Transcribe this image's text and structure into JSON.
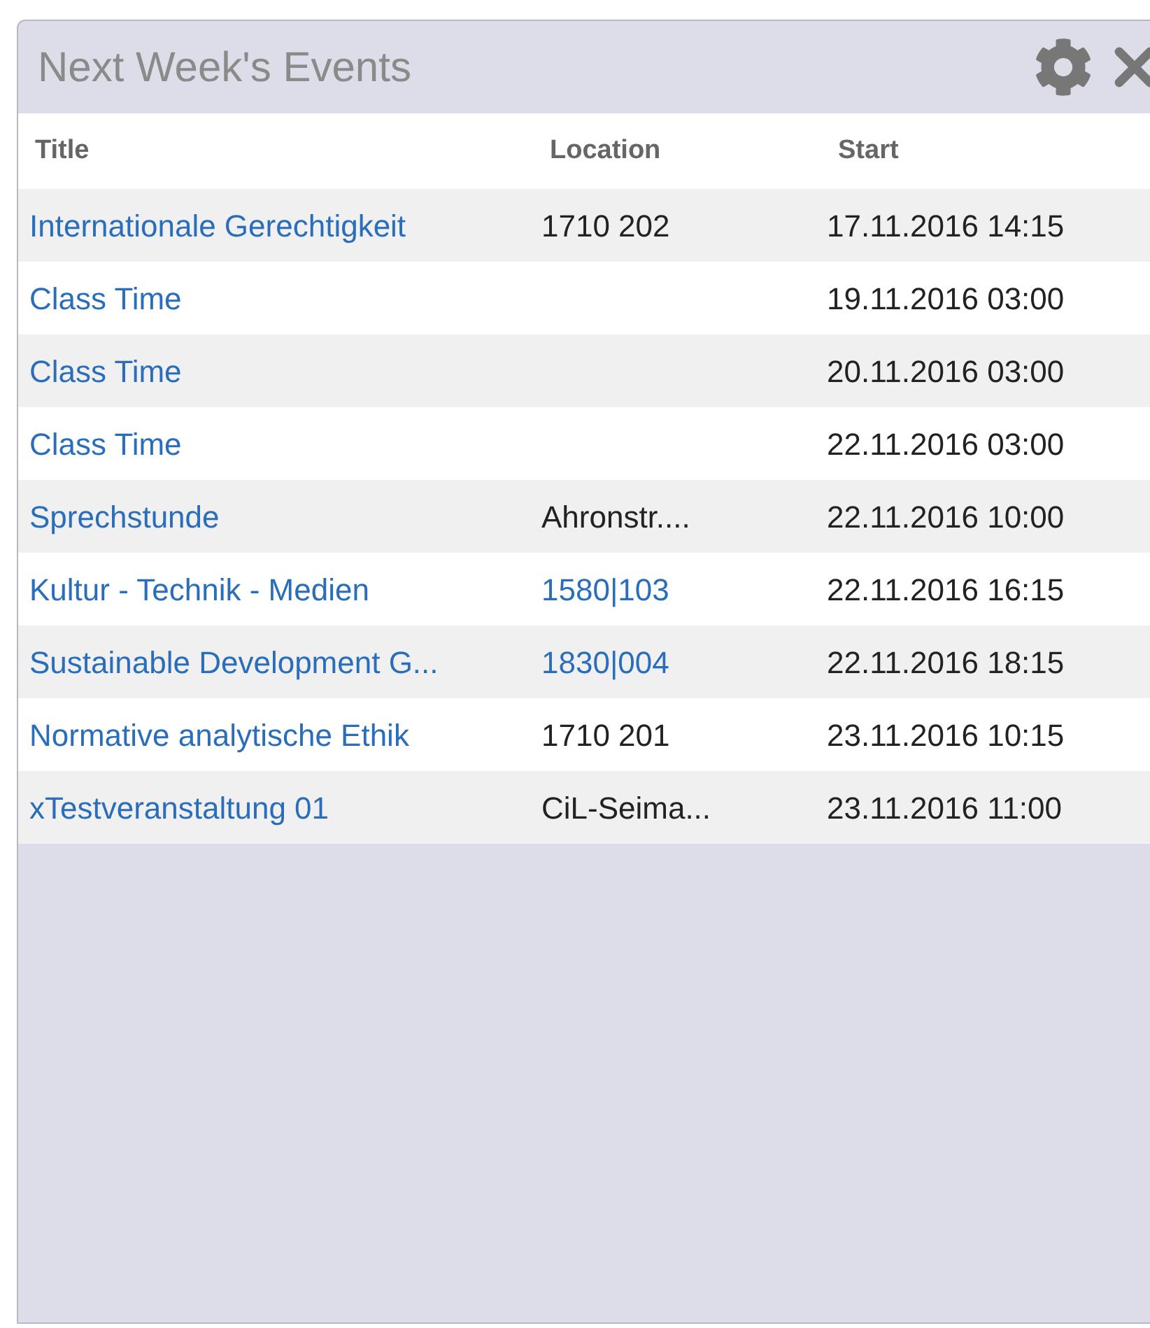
{
  "panel": {
    "title": "Next Week's Events"
  },
  "table": {
    "columns": [
      "Title",
      "Location",
      "Start"
    ],
    "rows": [
      {
        "title": "Internationale Gerechtigkeit",
        "location": {
          "text": "1710 202",
          "link": false
        },
        "start": "17.11.2016 14:15"
      },
      {
        "title": "Class Time",
        "start": "19.11.2016 03:00"
      },
      {
        "title": "Class Time",
        "start": "20.11.2016 03:00"
      },
      {
        "title": "Class Time",
        "start": "22.11.2016 03:00"
      },
      {
        "title": "Sprechstunde",
        "location": {
          "text": "Ahronstr....",
          "link": false
        },
        "start": "22.11.2016 10:00"
      },
      {
        "title": "Kultur - Technik - Medien",
        "location": {
          "text": "1580|103",
          "link": true
        },
        "start": "22.11.2016 16:15"
      },
      {
        "title": "Sustainable Development G...",
        "location": {
          "text": "1830|004",
          "link": true
        },
        "start": "22.11.2016 18:15"
      },
      {
        "title": "Normative analytische Ethik",
        "location": {
          "text": "1710 201",
          "link": false
        },
        "start": "23.11.2016 10:15"
      },
      {
        "title": "xTestveranstaltung 01",
        "location": {
          "text": "CiL-Seima...",
          "link": false
        },
        "start": "23.11.2016 11:00"
      }
    ]
  }
}
